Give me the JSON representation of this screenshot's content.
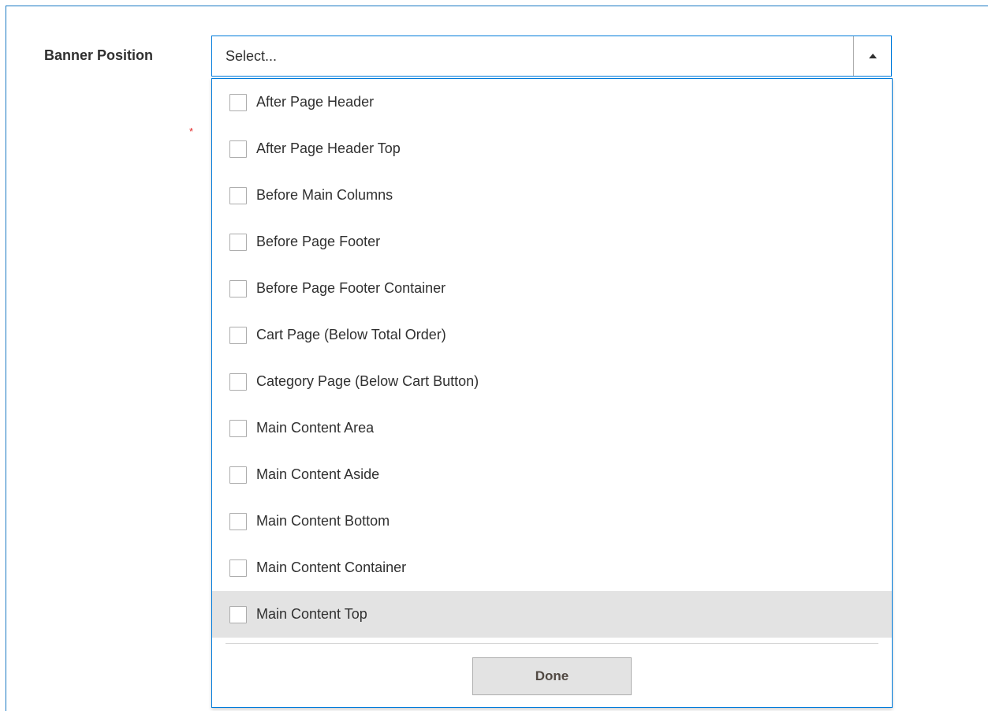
{
  "form": {
    "label": "Banner Position",
    "required_marker": "*"
  },
  "select": {
    "placeholder": "Select...",
    "state": "expanded",
    "toggle_icon": "caret-up-icon"
  },
  "options": [
    {
      "label": "After Page Header",
      "checked": false
    },
    {
      "label": "After Page Header Top",
      "checked": false
    },
    {
      "label": "Before Main Columns",
      "checked": false
    },
    {
      "label": "Before Page Footer",
      "checked": false
    },
    {
      "label": "Before Page Footer Container",
      "checked": false
    },
    {
      "label": "Cart Page (Below Total Order)",
      "checked": false
    },
    {
      "label": "Category Page (Below Cart Button)",
      "checked": false
    },
    {
      "label": "Main Content Area",
      "checked": false
    },
    {
      "label": "Main Content Aside",
      "checked": false
    },
    {
      "label": "Main Content Bottom",
      "checked": false
    },
    {
      "label": "Main Content Container",
      "checked": false
    },
    {
      "label": "Main Content Top",
      "checked": false,
      "highlighted": true
    }
  ],
  "actions": {
    "done_label": "Done"
  },
  "colors": {
    "focus_border": "#007bdb",
    "frame_border": "#1979c3",
    "highlight_bg": "#e3e3e3",
    "required": "#e22626"
  }
}
